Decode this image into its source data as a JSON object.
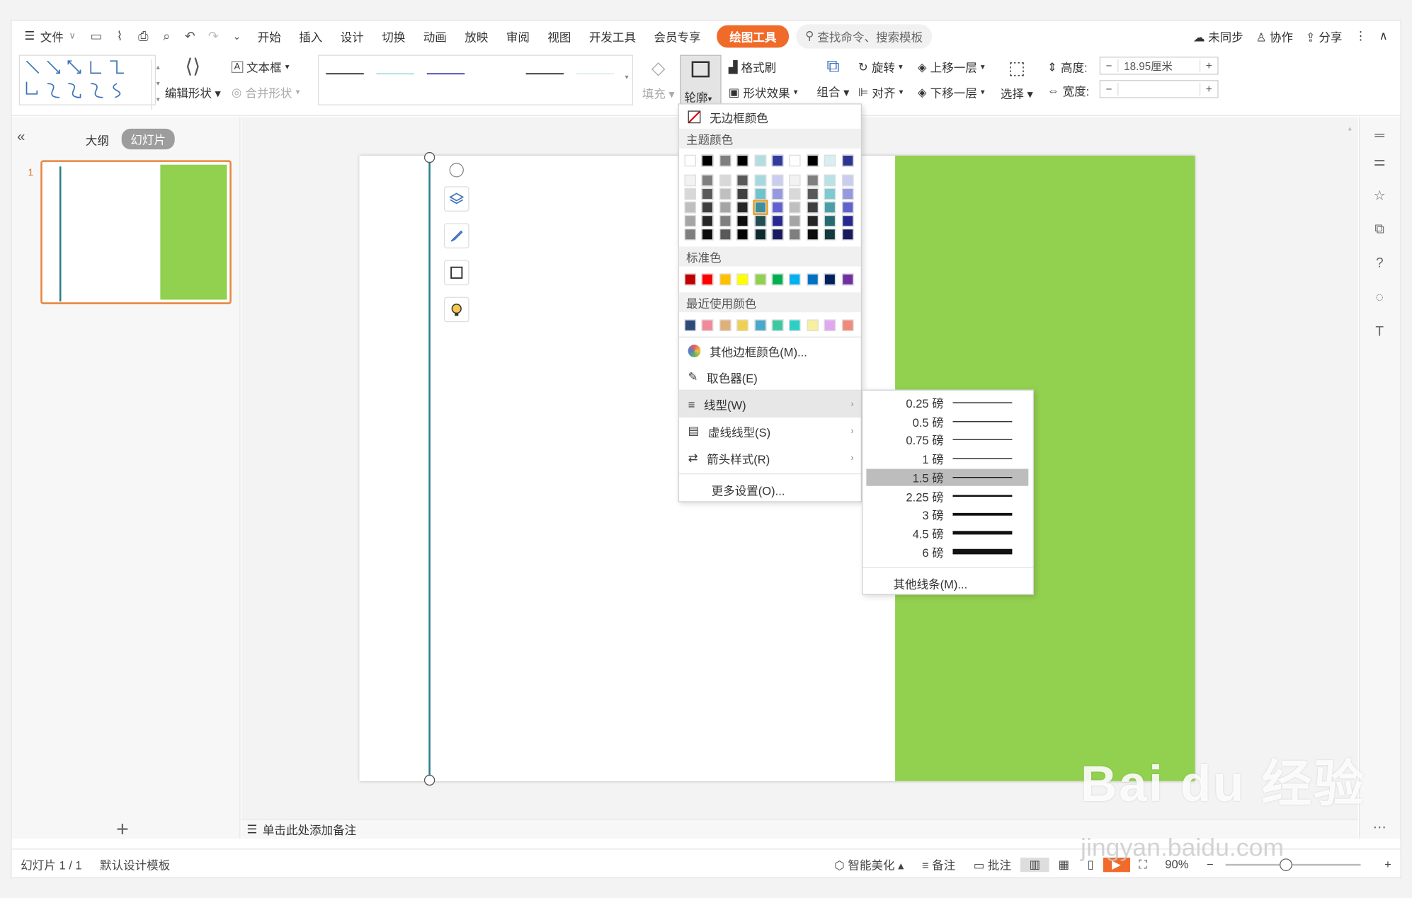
{
  "menubar": {
    "file": "文件",
    "tabs": [
      "开始",
      "插入",
      "设计",
      "切换",
      "动画",
      "放映",
      "审阅",
      "视图",
      "开发工具",
      "会员专享"
    ],
    "active_tab": "绘图工具",
    "search": "查找命令、搜索模板",
    "unsynced": "未同步",
    "collab": "协作",
    "share": "分享"
  },
  "ribbon": {
    "edit_shape": "编辑形状",
    "text_box": "文本框",
    "merge_shape": "合并形状",
    "fill": "填充",
    "outline": "轮廓",
    "format_painter": "格式刷",
    "shape_effect": "形状效果",
    "rotate": "旋转",
    "group": "组合",
    "align": "对齐",
    "bring_forward": "上移一层",
    "send_backward": "下移一层",
    "select": "选择",
    "height_label": "高度:",
    "height_value": "18.95厘米",
    "width_label": "宽度:",
    "width_value": "",
    "minus": "−",
    "plus": "+"
  },
  "leftpanel": {
    "tab_outline": "大纲",
    "tab_slides": "幻灯片",
    "slide_number": "1"
  },
  "notes": "单击此处添加备注",
  "status": {
    "slide_info": "幻灯片 1 / 1",
    "template": "默认设计模板",
    "smart": "智能美化",
    "notes": "备注",
    "comment": "批注",
    "zoom": "90%"
  },
  "dropdown": {
    "no_border": "无边框颜色",
    "theme_colors": "主题颜色",
    "standard_colors": "标准色",
    "recent_colors": "最近使用颜色",
    "more_colors": "其他边框颜色(M)...",
    "eyedropper": "取色器(E)",
    "line_type": "线型(W)",
    "dash_type": "虚线线型(S)",
    "arrow_style": "箭头样式(R)",
    "more_settings": "更多设置(O)...",
    "theme_top": [
      "#ffffff",
      "#000000",
      "#7f7f7f",
      "#000000",
      "#b4dde2",
      "#303b9e",
      "#ffffff",
      "#000000",
      "#d8eef0",
      "#2e3590"
    ],
    "theme_shades": [
      [
        "#f2f2f2",
        "#7f7f7f",
        "#d8d8d8",
        "#595959",
        "#a6d9df",
        "#cacdf0",
        "#f2f2f2",
        "#7f7f7f",
        "#b8e2e6",
        "#cacdf0"
      ],
      [
        "#d8d8d8",
        "#595959",
        "#bfbfbf",
        "#404040",
        "#6fc3cc",
        "#9699e0",
        "#d8d8d8",
        "#595959",
        "#7ccad2",
        "#9699e0"
      ],
      [
        "#bfbfbf",
        "#3f3f3f",
        "#a5a5a5",
        "#262626",
        "#3f8f98",
        "#6063cf",
        "#bfbfbf",
        "#3f3f3f",
        "#4b9ea6",
        "#6063cf"
      ],
      [
        "#a5a5a5",
        "#262626",
        "#7f7f7f",
        "#0d0d0d",
        "#1f4f55",
        "#262a8f",
        "#a5a5a5",
        "#262626",
        "#256a71",
        "#262a8f"
      ],
      [
        "#7f7f7f",
        "#0d0d0d",
        "#595959",
        "#000000",
        "#0d2a2d",
        "#181a5e",
        "#7f7f7f",
        "#0d0d0d",
        "#133a3e",
        "#181a5e"
      ]
    ],
    "standard": [
      "#c00000",
      "#ff0000",
      "#ffc000",
      "#ffff00",
      "#92d050",
      "#00b050",
      "#00b0f0",
      "#0070c0",
      "#002060",
      "#7030a0"
    ],
    "recent": [
      "#2e4a7a",
      "#f08a9a",
      "#e0b07a",
      "#f0d050",
      "#4aa8c8",
      "#3cc8a0",
      "#2ad0c8",
      "#f8f0a0",
      "#e0a8f0",
      "#f08a7a"
    ]
  },
  "submenu": {
    "widths": [
      {
        "label": "0.25 磅",
        "weight": 0.25
      },
      {
        "label": "0.5 磅",
        "weight": 0.5
      },
      {
        "label": "0.75 磅",
        "weight": 0.75
      },
      {
        "label": "1 磅",
        "weight": 1
      },
      {
        "label": "1.5 磅",
        "weight": 1.5
      },
      {
        "label": "2.25 磅",
        "weight": 2.25
      },
      {
        "label": "3 磅",
        "weight": 3
      },
      {
        "label": "4.5 磅",
        "weight": 4.5
      },
      {
        "label": "6 磅",
        "weight": 6
      }
    ],
    "selected_label": "1.5 磅",
    "more": "其他线条(M)..."
  },
  "watermark": {
    "brand": "Bai du 经验",
    "url": "jingyan.baidu.com"
  },
  "colors": {
    "accent": "#f06a2a",
    "slide_green": "#92d050",
    "line_teal": "#2a7d8c"
  }
}
